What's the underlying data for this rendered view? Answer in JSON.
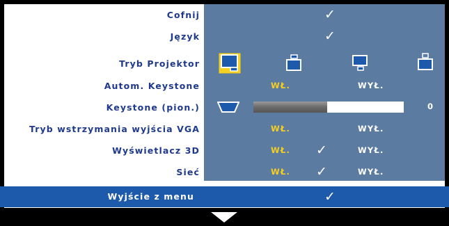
{
  "menu": {
    "items": [
      {
        "label": "Cofnij",
        "check": "✓"
      },
      {
        "label": "Język",
        "check": "✓"
      },
      {
        "label": "Tryb Projektor"
      },
      {
        "label": "Autom. Keystone",
        "on": "WŁ.",
        "off": "WYŁ."
      },
      {
        "label": "Keystone (pion.)",
        "value": "0",
        "slider_fraction": 0.49
      },
      {
        "label": "Tryb wstrzymania wyjścia VGA",
        "on": "WŁ.",
        "off": "WYŁ."
      },
      {
        "label": "Wyświetlacz 3D",
        "on": "WŁ.",
        "check": "✓",
        "off": "WYŁ."
      },
      {
        "label": "Sieć",
        "on": "WŁ.",
        "check": "✓",
        "off": "WYŁ."
      }
    ],
    "projector_modes": [
      "front-desktop-icon",
      "rear-desktop-icon",
      "front-ceiling-icon",
      "rear-ceiling-icon"
    ],
    "exit": {
      "label": "Wyjście z menu",
      "check": "✓"
    },
    "colors": {
      "label": "#1f3a8c",
      "panel": "#5b7ba1",
      "highlight": "#1e5aab",
      "on_text": "#f5d020"
    }
  }
}
